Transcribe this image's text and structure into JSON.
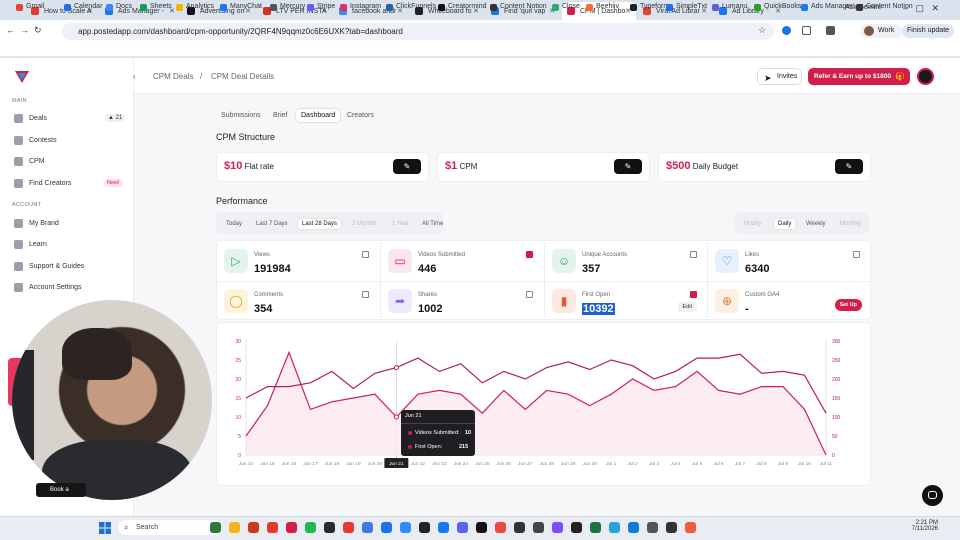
{
  "browser": {
    "tabs": [
      {
        "label": "How to Scale A",
        "color": "#e23a2e"
      },
      {
        "label": "Ads Manager -",
        "color": "#1877f2"
      },
      {
        "label": "Advertising on",
        "color": "#111"
      },
      {
        "label": "LTV PER INSTA",
        "color": "#d93025"
      },
      {
        "label": "facebook andr",
        "color": "#4285f4"
      },
      {
        "label": "Whiteboard fo",
        "color": "#222"
      },
      {
        "label": "Find 'quit vap",
        "color": "#1a73e8"
      },
      {
        "label": "CPM | Dashbo",
        "color": "#d21e4d"
      },
      {
        "label": "Viral Ad Librar",
        "color": "#ea4335"
      },
      {
        "label": "Ad Library",
        "color": "#1877f2"
      }
    ],
    "ask_gemini": "Ask Gemini",
    "url": "app.postedapp.com/dashboard/cpm-opportunity/2QRF4N9qqmz0c6E6UXK?tab=dashboard",
    "profile": "Work",
    "finish_update": "Finish update",
    "bookmarks": [
      "Gmail",
      "Calendar",
      "Docs",
      "Sheets",
      "Analytics",
      "ManyChat",
      "Mercury",
      "Stripe",
      "Instagram",
      "ClickFunnels",
      "Creatormind",
      "Content Notion",
      "Close",
      "Beehiiv",
      "Typeform",
      "SimpleTxt",
      "Lumanu",
      "QuickBooks",
      "Ads Manager",
      "Content Notion"
    ]
  },
  "sidebar": {
    "main_label": "MAIN",
    "account_label": "ACCOUNT",
    "items": [
      {
        "label": "Deals",
        "badge": "21"
      },
      {
        "label": "Contests"
      },
      {
        "label": "CPM"
      },
      {
        "label": "Find Creators",
        "badge": "New!"
      }
    ],
    "account_items": [
      {
        "label": "My Brand"
      },
      {
        "label": "Learn"
      },
      {
        "label": "Support & Guides"
      },
      {
        "label": "Account Settings"
      }
    ]
  },
  "breadcrumb": {
    "parent": "CPM Deals",
    "sep": "/",
    "current": "CPM Deal Details"
  },
  "header": {
    "invites": "Invites",
    "refer": "Refer & Earn up to $1800"
  },
  "subtabs": [
    "Submissions",
    "Brief",
    "Dashboard",
    "Creators"
  ],
  "active_subtab": "Dashboard",
  "cpm_structure": {
    "title": "CPM Structure",
    "items": [
      {
        "amount": "$10",
        "label": "Flat rate"
      },
      {
        "amount": "$1",
        "label": "CPM"
      },
      {
        "amount": "$500",
        "label": "Daily Budget"
      }
    ]
  },
  "performance": {
    "title": "Performance",
    "ranges": [
      "Today",
      "Last 7 Days",
      "Last 28 Days",
      "3 Months",
      "1 Year",
      "All Time"
    ],
    "granularity": [
      "Hourly",
      "Daily",
      "Weekly",
      "Monthly"
    ]
  },
  "metrics": [
    {
      "label": "Views",
      "value": "191984",
      "checked": false,
      "color": "#2f9e6e",
      "bg": "#e4f4ec",
      "icon": "play-icon"
    },
    {
      "label": "Videos Submitted",
      "value": "446",
      "checked": true,
      "color": "#d21e4d",
      "bg": "#fde7ec",
      "icon": "video-icon"
    },
    {
      "label": "Unique Accounts",
      "value": "357",
      "checked": false,
      "color": "#2f9e6e",
      "bg": "#e4f4ec",
      "icon": "user-icon"
    },
    {
      "label": "Likes",
      "value": "6340",
      "checked": false,
      "color": "#3b82f6",
      "bg": "#e6f0fe",
      "icon": "heart-icon"
    },
    {
      "label": "Comments",
      "value": "354",
      "checked": false,
      "color": "#e0a10c",
      "bg": "#fdf4dc",
      "icon": "comment-icon"
    },
    {
      "label": "Shares",
      "value": "1002",
      "checked": false,
      "color": "#8b5cf6",
      "bg": "#efe9fe",
      "icon": "share-icon"
    },
    {
      "label": "First Open",
      "value": "10392",
      "checked": true,
      "color": "#e05a2b",
      "bg": "#fde9e2",
      "icon": "bar-icon",
      "action": "Edit"
    },
    {
      "label": "Custom GA4",
      "value": "-",
      "checked": false,
      "color": "#e07a2b",
      "bg": "#fdefe2",
      "icon": "plus-icon",
      "action": "Set Up"
    }
  ],
  "tooltip": {
    "date": "Jun 21",
    "rows": [
      {
        "label": "Videos Submitted:",
        "value": "10"
      },
      {
        "label": "First Open:",
        "value": "215"
      }
    ]
  },
  "chart_data": {
    "type": "line",
    "x": [
      "Jun 14",
      "Jun 15",
      "Jun 16",
      "Jun 17",
      "Jun 18",
      "Jun 19",
      "Jun 20",
      "Jun 21",
      "Jun 22",
      "Jun 23",
      "Jun 24",
      "Jun 25",
      "Jun 26",
      "Jun 27",
      "Jun 28",
      "Jun 29",
      "Jun 30",
      "Jul 1",
      "Jul 2",
      "Jul 3",
      "Jul 4",
      "Jul 5",
      "Jul 6",
      "Jul 7",
      "Jul 8",
      "Jul 9",
      "Jul 10",
      "Jul 11"
    ],
    "series": [
      {
        "name": "Videos Submitted",
        "axis": "left",
        "color": "#d21e4d",
        "values": [
          5,
          13,
          27,
          12,
          14,
          15,
          16,
          10,
          16,
          17,
          16,
          11,
          17,
          12,
          17,
          16,
          13,
          16,
          20,
          17,
          18,
          22,
          17,
          16,
          18,
          18,
          12,
          0
        ]
      },
      {
        "name": "First Open",
        "axis": "right",
        "color": "#b6204a",
        "values": [
          150,
          180,
          180,
          190,
          220,
          175,
          215,
          230,
          255,
          220,
          240,
          190,
          220,
          200,
          230,
          245,
          225,
          250,
          235,
          200,
          220,
          255,
          255,
          265,
          215,
          220,
          210,
          110
        ]
      }
    ],
    "ylim_left": [
      0,
      30
    ],
    "ylim_right": [
      0,
      300
    ],
    "yticks_left": [
      0,
      5,
      10,
      15,
      20,
      25,
      30
    ],
    "yticks_right": [
      0,
      50,
      100,
      150,
      200,
      250,
      300
    ],
    "highlight": "Jun 21"
  },
  "video_overlay": {
    "button": "Book a"
  },
  "taskbar": {
    "search": "Search",
    "time": "2:21 PM",
    "date": "7/11/2026"
  }
}
